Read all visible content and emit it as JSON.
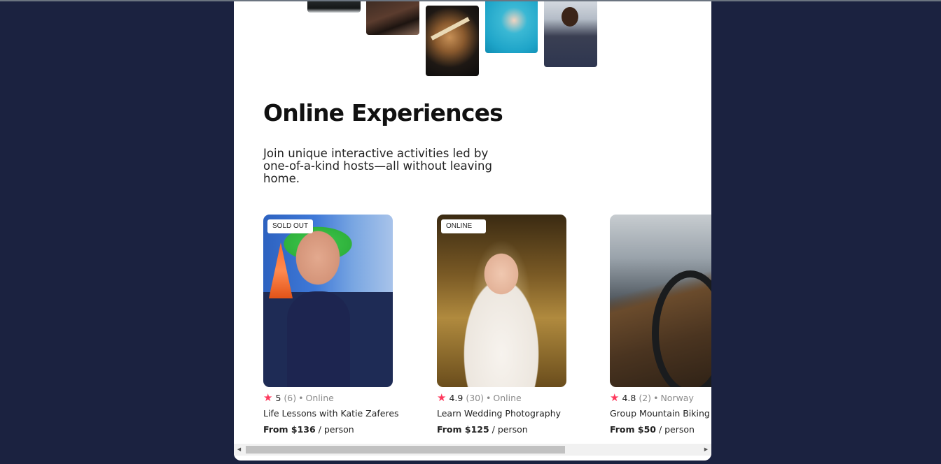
{
  "section": {
    "heading": "Online Experiences",
    "subtitle": "Join unique interactive activities led by one-of-a-kind hosts—all without leaving home."
  },
  "cards": [
    {
      "badge": "SOLD OUT",
      "rating": "5",
      "reviews": "(6)",
      "location": "Online",
      "title": "Life Lessons with Katie Zaferes",
      "price_prefix": "From $136",
      "price_suffix": " / person"
    },
    {
      "badge": "ONLINE",
      "rating": "4.9",
      "reviews": "(30)",
      "location": "Online",
      "title": "Learn Wedding Photography",
      "price_prefix": "From $125",
      "price_suffix": " / person"
    },
    {
      "badge": "",
      "rating": "4.8",
      "reviews": "(2)",
      "location": "Norway",
      "title": "Group Mountain Biking",
      "price_prefix": "From $50",
      "price_suffix": " / person"
    }
  ],
  "icons": {
    "star": "★",
    "separator": "•",
    "scroll_left": "◀",
    "scroll_right": "▶"
  },
  "colors": {
    "background": "#1b2240",
    "star": "#fe385c"
  }
}
